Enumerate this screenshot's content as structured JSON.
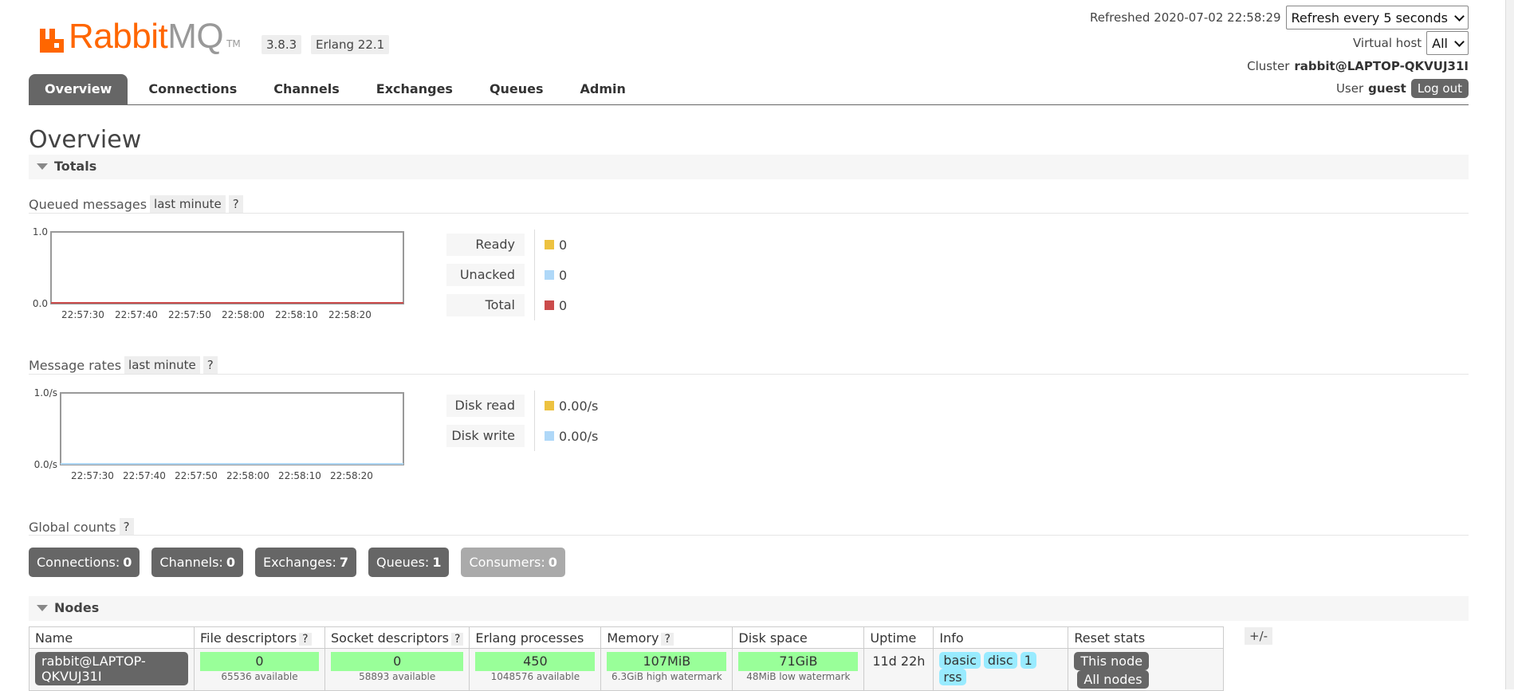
{
  "header": {
    "logo_rabbit": "Rabbit",
    "logo_mq": "MQ",
    "logo_tm": "TM",
    "version": "3.8.3",
    "erlang": "Erlang 22.1",
    "refreshed_label": "Refreshed",
    "refreshed_time": "2020-07-02 22:58:29",
    "refresh_select": "Refresh every 5 seconds",
    "vhost_label": "Virtual host",
    "vhost_select": "All",
    "cluster_label": "Cluster",
    "cluster_name": "rabbit@LAPTOP-QKVUJ31I",
    "user_label": "User",
    "user_name": "guest",
    "logout": "Log out"
  },
  "tabs": [
    {
      "label": "Overview",
      "active": true
    },
    {
      "label": "Connections"
    },
    {
      "label": "Channels"
    },
    {
      "label": "Exchanges"
    },
    {
      "label": "Queues"
    },
    {
      "label": "Admin"
    }
  ],
  "page": {
    "title": "Overview",
    "totals_section": "Totals",
    "nodes_section": "Nodes"
  },
  "queued": {
    "title": "Queued messages",
    "range": "last minute",
    "help": "?",
    "legend": [
      {
        "label": "Ready",
        "value": "0",
        "color": "#edc240"
      },
      {
        "label": "Unacked",
        "value": "0",
        "color": "#afd8f8"
      },
      {
        "label": "Total",
        "value": "0",
        "color": "#cb4b4b"
      }
    ]
  },
  "rates": {
    "title": "Message rates",
    "range": "last minute",
    "help": "?",
    "legend": [
      {
        "label": "Disk read",
        "value": "0.00/s",
        "color": "#edc240"
      },
      {
        "label": "Disk write",
        "value": "0.00/s",
        "color": "#afd8f8"
      }
    ]
  },
  "chart_data": [
    {
      "type": "line",
      "x": [
        "22:57:30",
        "22:57:40",
        "22:57:50",
        "22:58:00",
        "22:58:10",
        "22:58:20"
      ],
      "y_tick_labels": [
        "0.0",
        "1.0"
      ],
      "ylim": [
        0,
        1
      ],
      "series": [
        {
          "name": "Ready",
          "values": [
            0,
            0,
            0,
            0,
            0,
            0
          ],
          "color": "#edc240"
        },
        {
          "name": "Unacked",
          "values": [
            0,
            0,
            0,
            0,
            0,
            0
          ],
          "color": "#afd8f8"
        },
        {
          "name": "Total",
          "values": [
            0,
            0,
            0,
            0,
            0,
            0
          ],
          "color": "#cb4b4b"
        }
      ]
    },
    {
      "type": "line",
      "x": [
        "22:57:30",
        "22:57:40",
        "22:57:50",
        "22:58:00",
        "22:58:10",
        "22:58:20"
      ],
      "y_tick_labels": [
        "0.0/s",
        "1.0/s"
      ],
      "ylim": [
        0,
        1
      ],
      "series": [
        {
          "name": "Disk read",
          "values": [
            0,
            0,
            0,
            0,
            0,
            0
          ],
          "color": "#edc240"
        },
        {
          "name": "Disk write",
          "values": [
            0,
            0,
            0,
            0,
            0,
            0
          ],
          "color": "#afd8f8"
        }
      ]
    }
  ],
  "global": {
    "title": "Global counts",
    "help": "?",
    "counts": [
      {
        "label": "Connections:",
        "value": "0"
      },
      {
        "label": "Channels:",
        "value": "0"
      },
      {
        "label": "Exchanges:",
        "value": "7"
      },
      {
        "label": "Queues:",
        "value": "1"
      },
      {
        "label": "Consumers:",
        "value": "0"
      }
    ]
  },
  "nodes": {
    "headers": [
      "Name",
      "File descriptors",
      "Socket descriptors",
      "Erlang processes",
      "Memory",
      "Disk space",
      "Uptime",
      "Info",
      "Reset stats"
    ],
    "help": "?",
    "plus_minus": "+/-",
    "row": {
      "name": "rabbit@LAPTOP-QKVUJ31I",
      "fd": "0",
      "fd_sub": "65536 available",
      "sd": "0",
      "sd_sub": "58893 available",
      "ep": "450",
      "ep_sub": "1048576 available",
      "mem": "107MiB",
      "mem_sub": "6.3GiB high watermark",
      "disk": "71GiB",
      "disk_sub": "48MiB low watermark",
      "uptime": "11d 22h",
      "info": [
        "basic",
        "disc",
        "1",
        "rss"
      ],
      "reset_this": "This node",
      "reset_all": "All nodes"
    }
  }
}
